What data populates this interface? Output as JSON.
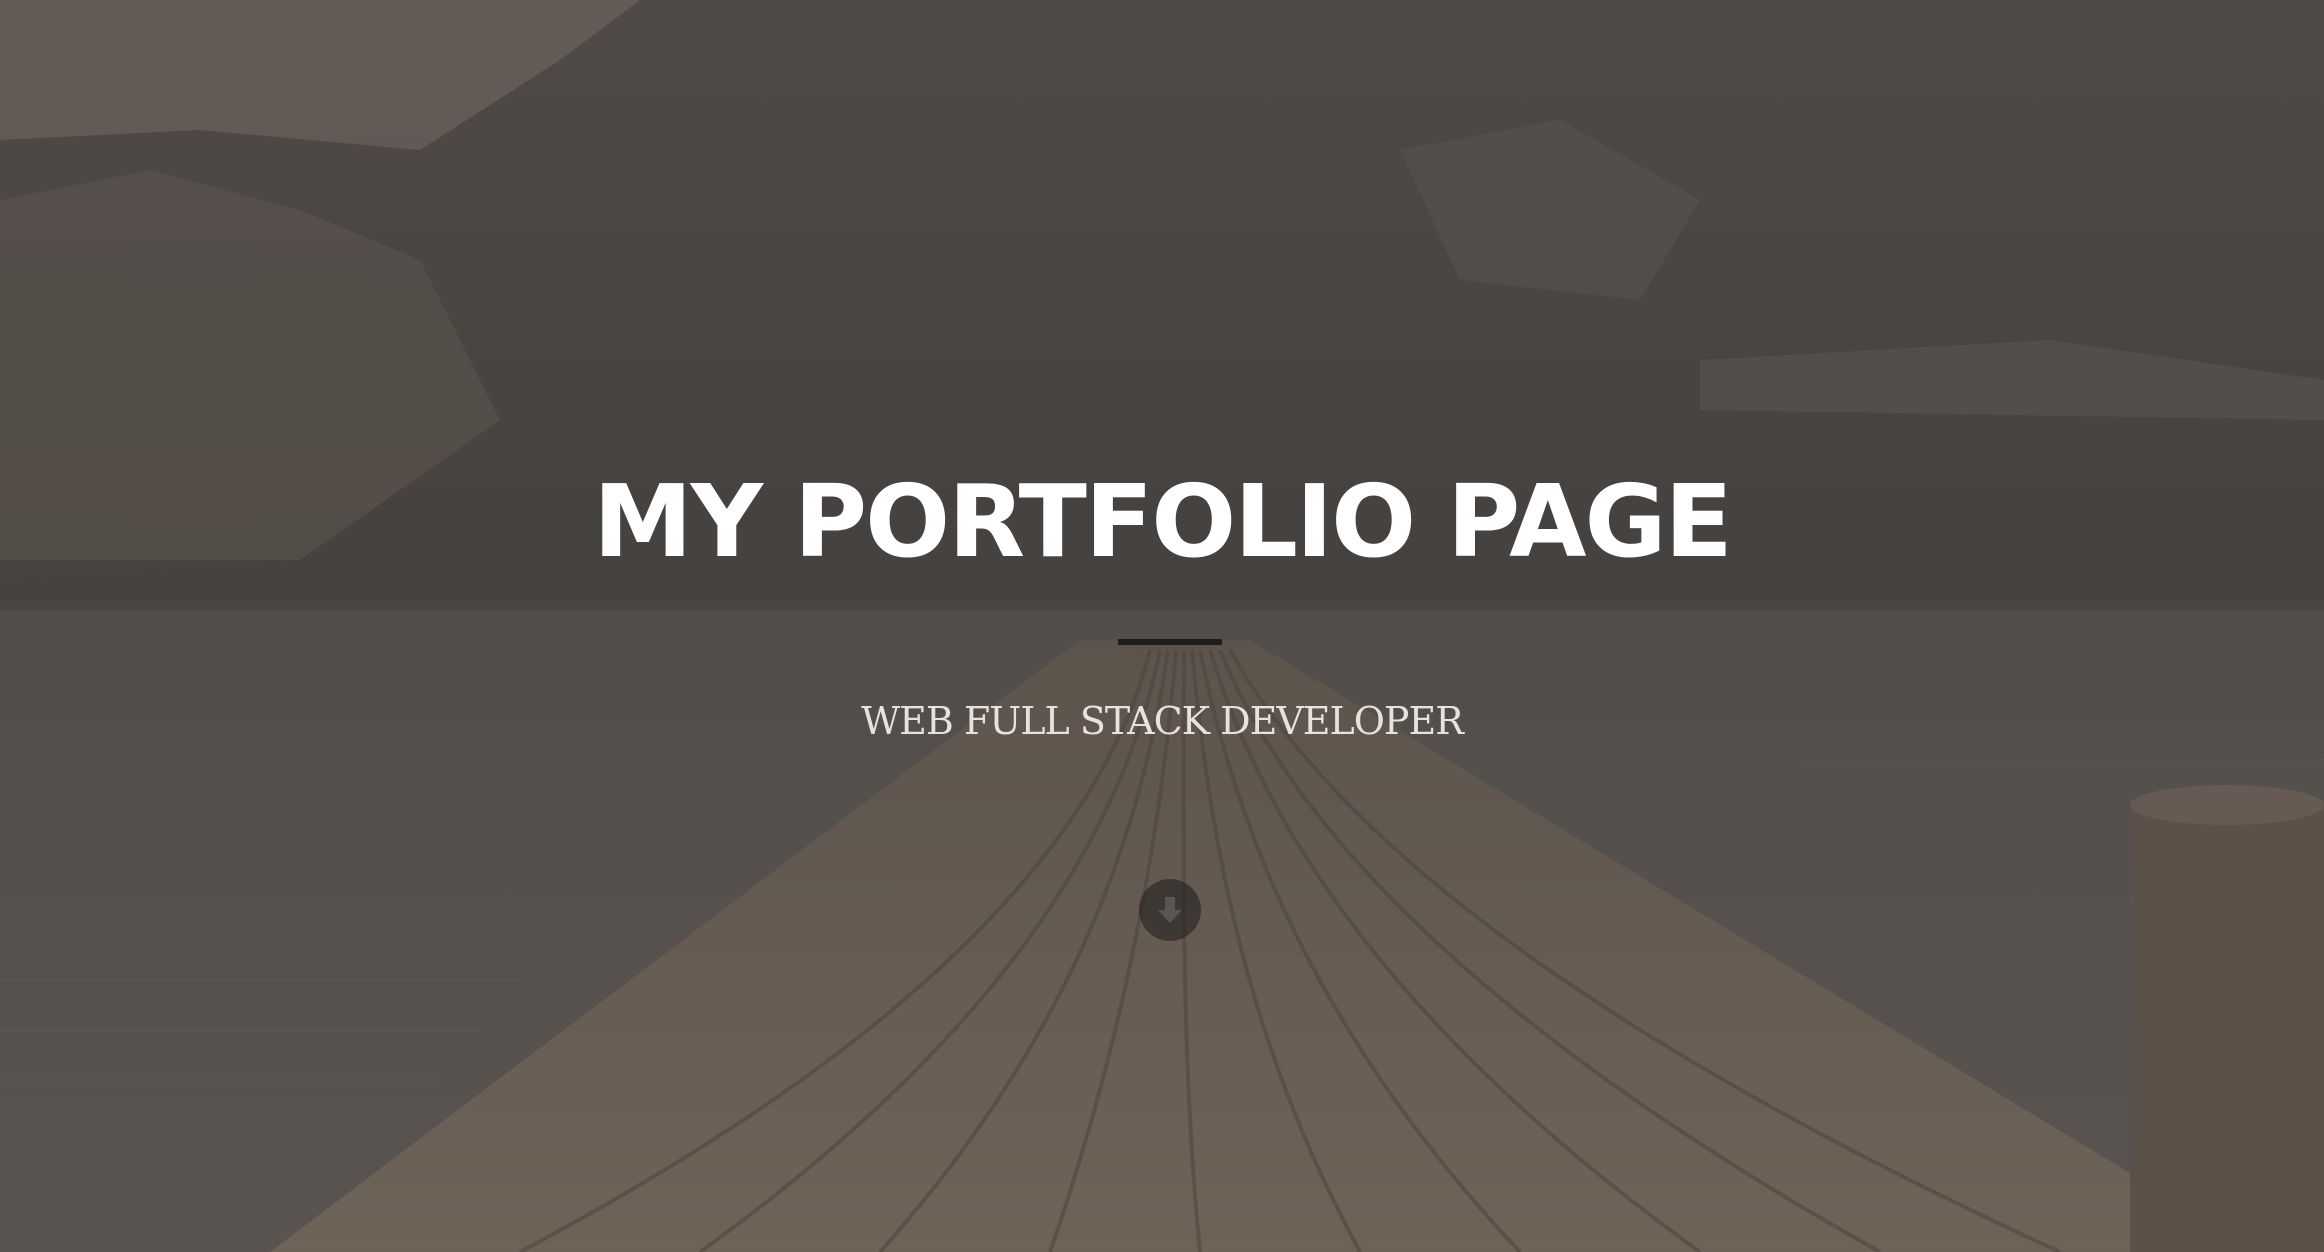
{
  "hero": {
    "title": "MY PORTFOLIO PAGE",
    "subtitle": "WEB FULL STACK DEVELOPER",
    "scroll_icon": "arrow-circle-down-icon"
  },
  "colors": {
    "title": "#ffffff",
    "subtitle": "#e6e2dc",
    "divider": "#1e1e1e",
    "overlay": "#3c3a38"
  }
}
